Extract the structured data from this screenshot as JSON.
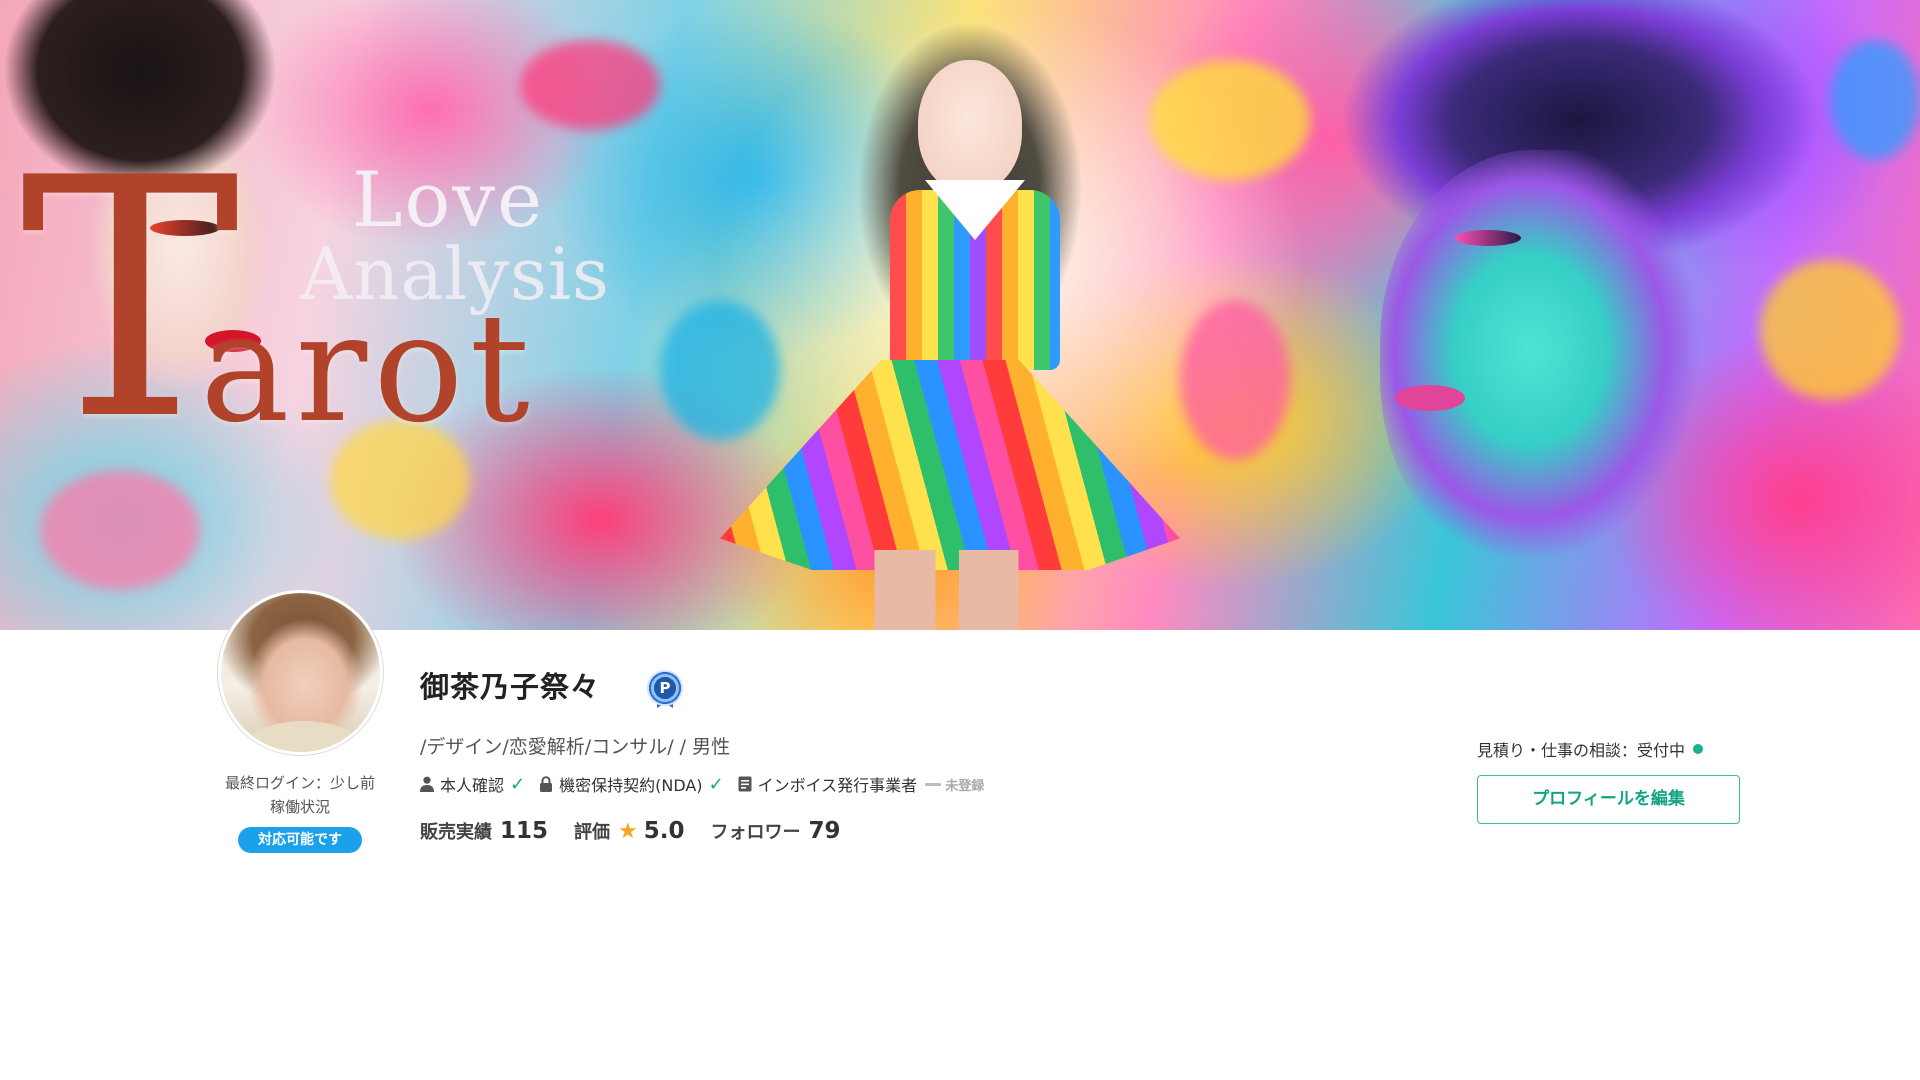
{
  "banner": {
    "title_line1": "Love",
    "title_line2": "Analysis",
    "title_main_initial": "T",
    "title_main_rest": "arot"
  },
  "profile": {
    "name": "御茶乃子祭々",
    "badge_letter": "P",
    "tagline": "/デザイン/恋愛解析/コンサル/ / 男性",
    "last_login": "最終ログイン：少し前",
    "work_status_label": "稼働状況",
    "availability": "対応可能です"
  },
  "verification": {
    "identity": "本人確認",
    "nda": "機密保持契約(NDA)",
    "invoice": "インボイス発行事業者",
    "invoice_status": "未登録"
  },
  "stats": {
    "sales_label": "販売実績",
    "sales_value": "115",
    "rating_label": "評価",
    "rating_value": "5.0",
    "followers_label": "フォロワー",
    "followers_value": "79"
  },
  "consultation": {
    "status_text": "見積り・仕事の相談：受付中"
  },
  "actions": {
    "edit_profile": "プロフィールを編集"
  },
  "colors": {
    "accent_green": "#16a589",
    "badge_blue": "#1aa1e9",
    "star": "#f5a623",
    "tarot_title": "#b0432a"
  },
  "icons": {
    "identity": "person-icon",
    "nda": "lock-icon",
    "invoice": "document-icon",
    "check": "check-icon",
    "rating": "star-icon",
    "status": "status-dot-icon",
    "badge": "p-rank-badge-icon"
  }
}
